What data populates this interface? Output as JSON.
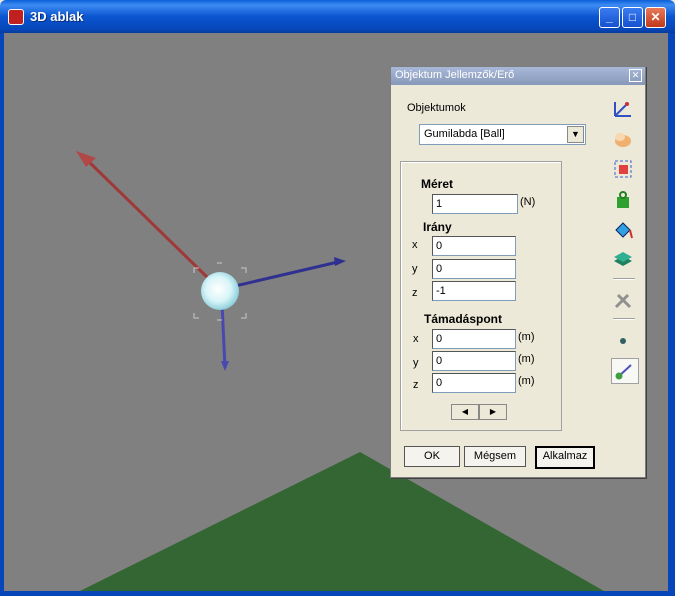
{
  "window": {
    "title": "3D ablak"
  },
  "dialog": {
    "title": "Objektum Jellemzők/Erő",
    "objects_label": "Objektumok",
    "selected_object": "Gumilabda   [Ball]",
    "size_label": "Méret",
    "size_value": "1",
    "size_unit": "(N)",
    "direction_label": "Irány",
    "direction": {
      "x": "0",
      "y": "0",
      "z": "-1"
    },
    "attack_point_label": "Támadáspont",
    "attack_point": {
      "x": "0",
      "y": "0",
      "z": "0"
    },
    "unit_m": "(m)",
    "axis_x": "x",
    "axis_y": "y",
    "axis_z": "z",
    "ok_label": "OK",
    "cancel_label": "Mégsem",
    "apply_label": "Alkalmaz"
  },
  "colors": {
    "force_red": "#b04040",
    "force_blue": "#3030a0",
    "ground": "#336633",
    "viewport": "#808080"
  }
}
